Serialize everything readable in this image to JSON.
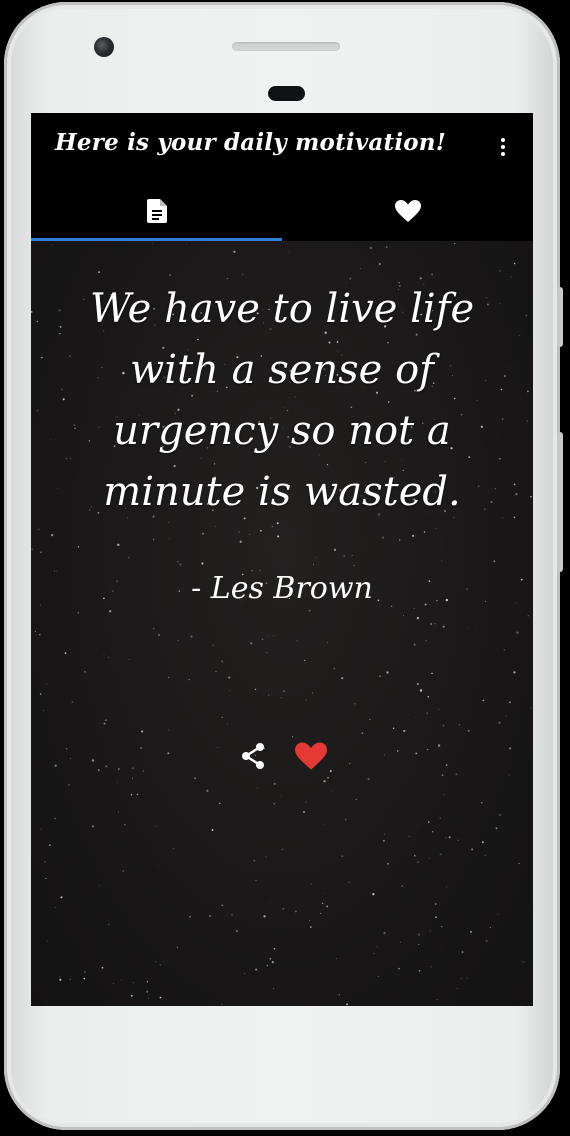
{
  "app": {
    "title": "Here is your daily motivation!",
    "accent_color": "#2f7fd9",
    "favorite_color": "#e53935"
  },
  "appbar": {
    "menu_icon": "more-vertical-icon"
  },
  "tabs": [
    {
      "icon": "document-icon",
      "selected": true
    },
    {
      "icon": "heart-icon",
      "selected": false
    }
  ],
  "quote": {
    "text": "We have to live life with a sense of urgency so not a minute is wasted.",
    "author": "- Les Brown",
    "favorited": true
  },
  "actions": {
    "share_icon": "share-icon",
    "favorite_icon": "heart-icon"
  }
}
